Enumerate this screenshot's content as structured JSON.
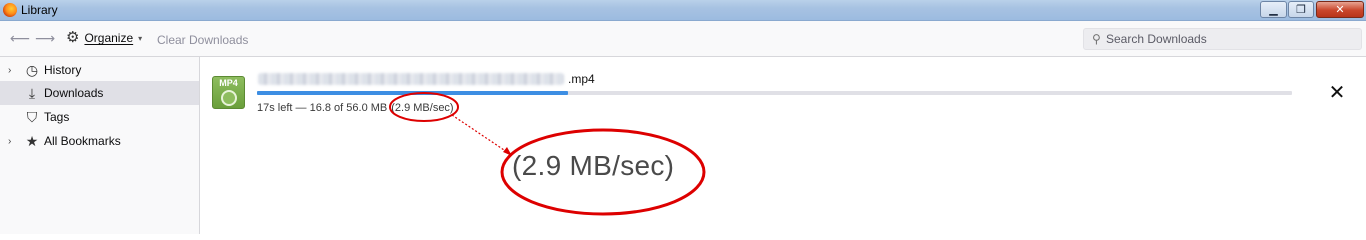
{
  "window": {
    "title": "Library"
  },
  "toolbar": {
    "organize_label": "Organize",
    "clear_downloads_label": "Clear Downloads",
    "search_placeholder": "Search Downloads"
  },
  "sidebar": {
    "items": [
      {
        "label": "History",
        "icon": "clock-icon"
      },
      {
        "label": "Downloads",
        "icon": "download-icon"
      },
      {
        "label": "Tags",
        "icon": "tag-icon"
      },
      {
        "label": "All Bookmarks",
        "icon": "star-icon"
      }
    ]
  },
  "download": {
    "icon_tag": "MP4",
    "extension": ".mp4",
    "progress_fraction": 0.3,
    "status_prefix": "17s left — 16.8 of 56.0 MB",
    "speed": "(2.9 MB/sec)"
  },
  "annotation": {
    "zoom_text": "(2.9 MB/sec)",
    "color": "#dd0000"
  }
}
